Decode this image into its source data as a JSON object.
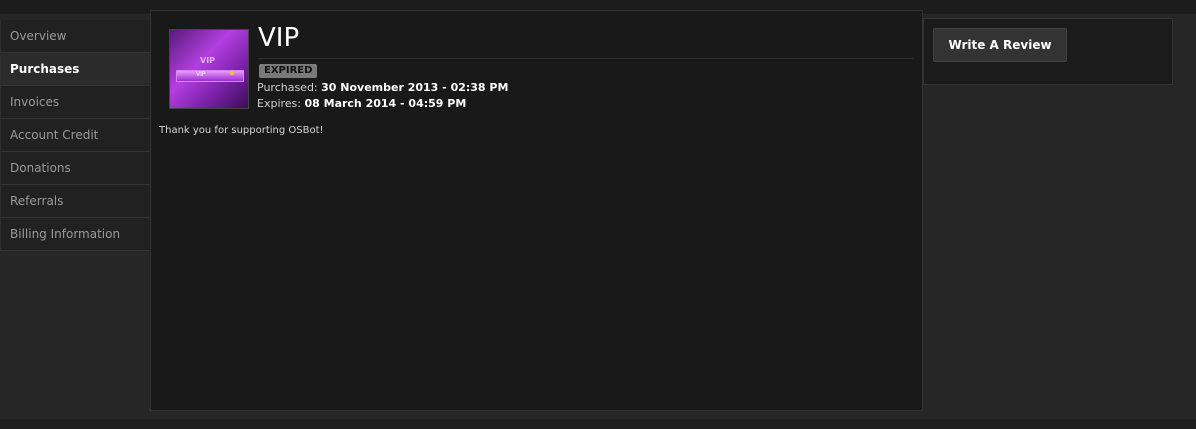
{
  "sidebar": {
    "items": [
      {
        "label": "Overview"
      },
      {
        "label": "Purchases"
      },
      {
        "label": "Invoices"
      },
      {
        "label": "Account Credit"
      },
      {
        "label": "Donations"
      },
      {
        "label": "Referrals"
      },
      {
        "label": "Billing Information"
      }
    ],
    "active_label": "Purchases"
  },
  "purchase": {
    "title": "VIP",
    "status_badge": "EXPIRED",
    "purchased_label": "Purchased:",
    "purchased_value": "30 November 2013 - 02:38 PM",
    "expires_label": "Expires:",
    "expires_value": "08 March 2014 - 04:59 PM",
    "message": "Thank you for supporting OSBot!",
    "thumbnail": {
      "text": "VIP",
      "bar_text": "VIP"
    }
  },
  "actions": {
    "write_review_label": "Write A Review"
  },
  "colors": {
    "accent_purple": "#b23fe0",
    "badge_gray": "#7a7a7a",
    "background": "#191919"
  }
}
